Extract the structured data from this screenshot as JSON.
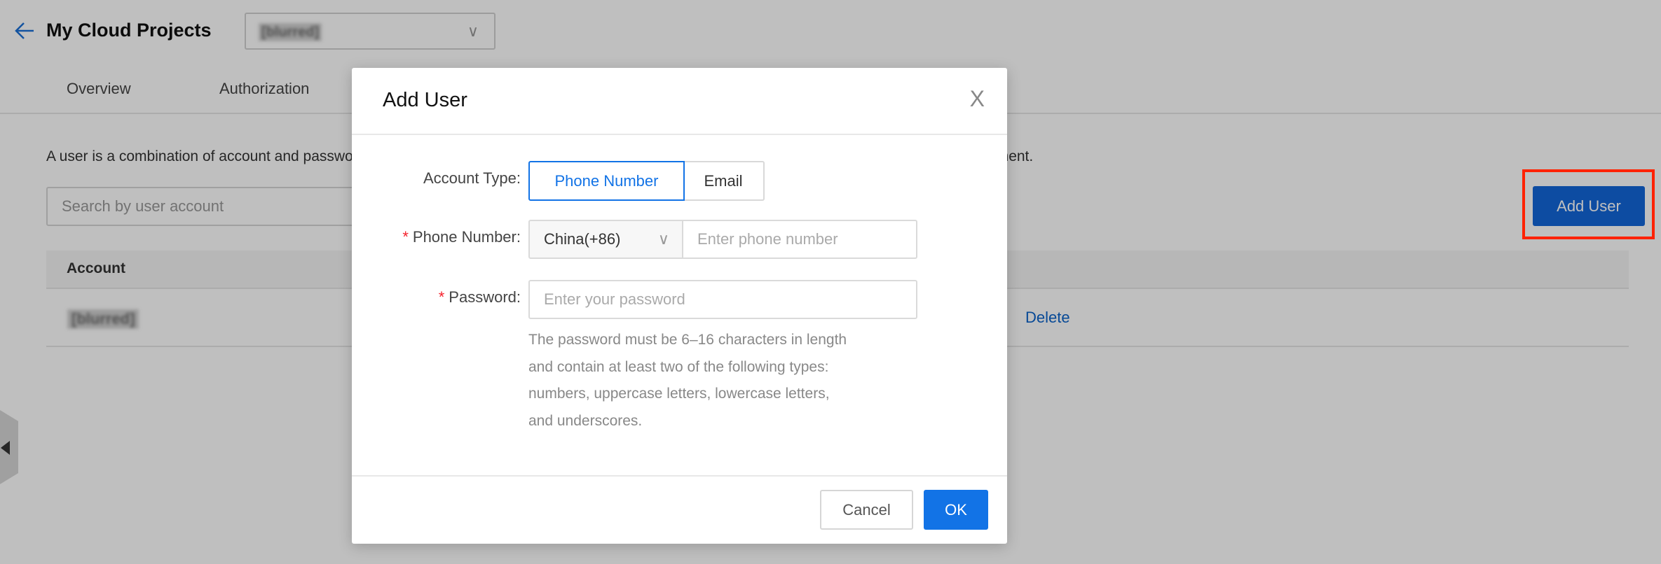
{
  "header": {
    "title": "My Cloud Projects",
    "back_icon": "arrow-left-icon",
    "project_selector_value": "[blurred]"
  },
  "tabs": [
    {
      "label": "Overview"
    },
    {
      "label": "Authorization"
    }
  ],
  "main": {
    "description": "A user is a combination of account and password. The user cannot use any assets by default. The user must be authorized through asset management.",
    "search_placeholder": "Search by user account",
    "add_user_label": "Add User",
    "table": {
      "columns": [
        "Account"
      ],
      "rows": [
        {
          "account": "[blurred]",
          "action": "Delete"
        }
      ]
    }
  },
  "highlight_color": "#ff2200",
  "dialog": {
    "title": "Add User",
    "close_label": "X",
    "account_type_label": "Account Type",
    "account_type_options": [
      "Phone Number",
      "Email"
    ],
    "account_type_selected": "Phone Number",
    "phone_label": "Phone Number",
    "country_code": "China(+86)",
    "phone_placeholder": "Enter phone number",
    "password_label": "Password",
    "password_placeholder": "Enter your password",
    "password_help": [
      "The password must be 6–16 characters in length",
      "and contain at least two of the following types:",
      "numbers, uppercase letters, lowercase letters,",
      "and underscores."
    ],
    "cancel_label": "Cancel",
    "ok_label": "OK",
    "required_mark": "*",
    "colon": ":"
  },
  "colors": {
    "primary": "#1273e6",
    "required": "#f5222d"
  }
}
